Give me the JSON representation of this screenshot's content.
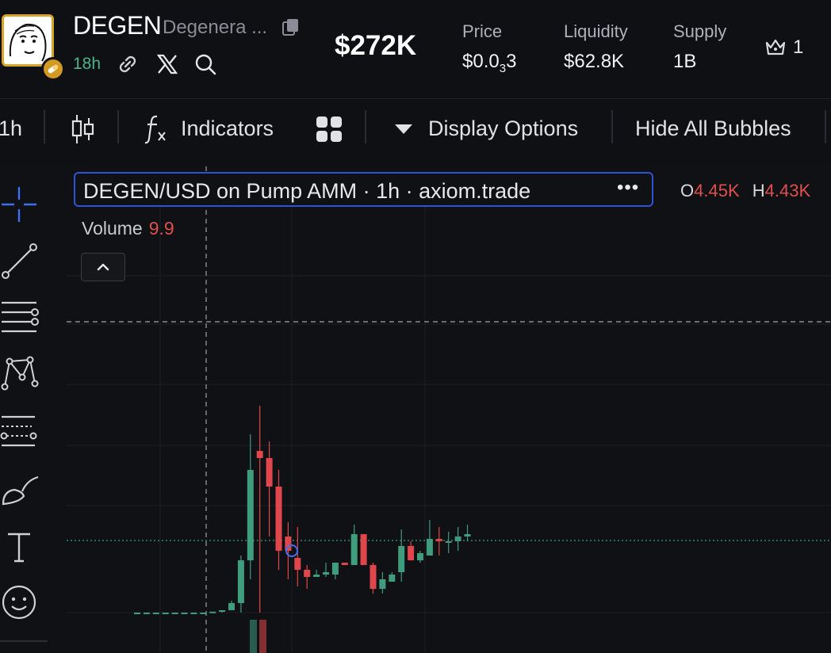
{
  "header": {
    "symbol": "DEGEN",
    "name": "Degenera ...",
    "age": "18h",
    "market_cap": "$272K",
    "stats": {
      "price_label": "Price",
      "price_value_main": "$0.0",
      "price_value_sub": "3",
      "price_value_tail": "3",
      "liquidity_label": "Liquidity",
      "liquidity_value": "$62.8K",
      "supply_label": "Supply",
      "supply_value": "1B"
    },
    "holders_count": "1"
  },
  "toolbar": {
    "interval": "1h",
    "indicators_label": "Indicators",
    "display_options_label": "Display Options",
    "hide_bubbles_label": "Hide All Bubbles"
  },
  "chart": {
    "legend_title": "DEGEN/USD on Pump AMM · 1h · axiom.trade",
    "legend_more": "•••",
    "ohlc": {
      "o_label": "O",
      "o_value": "4.45K",
      "h_label": "H",
      "h_value": "4.43K"
    },
    "volume_label": "Volume",
    "volume_value": "9.9"
  },
  "colors": {
    "up": "#3f9c7c",
    "down": "#e0474c",
    "accent": "#2f53d6",
    "badge": "#d39a22",
    "age_green": "#4fb286"
  },
  "icons": [
    "copy-icon",
    "pill-icon",
    "link-icon",
    "x-logo-icon",
    "search-icon",
    "crown-icon",
    "candlestick-icon",
    "function-icon",
    "grid-icon",
    "caret-down-icon",
    "crosshair-icon",
    "trend-line-icon",
    "horizontal-lines-icon",
    "pattern-icon",
    "fib-icon",
    "brush-icon",
    "text-icon",
    "emoji-icon",
    "chevron-up-icon"
  ],
  "chart_data": {
    "type": "candlestick",
    "interval": "1h",
    "candles": [
      {
        "o": 2.2,
        "h": 2.2,
        "l": 2.2,
        "c": 2.2
      },
      {
        "o": 2.2,
        "h": 2.2,
        "l": 2.2,
        "c": 2.2
      },
      {
        "o": 2.2,
        "h": 2.2,
        "l": 2.2,
        "c": 2.2
      },
      {
        "o": 2.2,
        "h": 2.2,
        "l": 2.2,
        "c": 2.2
      },
      {
        "o": 2.2,
        "h": 2.2,
        "l": 2.2,
        "c": 2.2
      },
      {
        "o": 2.2,
        "h": 2.2,
        "l": 2.2,
        "c": 2.2
      },
      {
        "o": 2.2,
        "h": 2.2,
        "l": 2.2,
        "c": 2.2
      },
      {
        "o": 2.2,
        "h": 2.2,
        "l": 2.2,
        "c": 2.2
      },
      {
        "o": 2.2,
        "h": 2.2,
        "l": 2.2,
        "c": 2.22
      },
      {
        "o": 2.22,
        "h": 2.25,
        "l": 2.2,
        "c": 2.25
      },
      {
        "o": 2.25,
        "h": 2.45,
        "l": 2.25,
        "c": 2.4
      },
      {
        "o": 2.4,
        "h": 3.4,
        "l": 2.2,
        "c": 3.3
      },
      {
        "o": 3.3,
        "h": 5.95,
        "l": 2.9,
        "c": 5.2
      },
      {
        "o": 5.6,
        "h": 6.55,
        "l": 2.2,
        "c": 5.45
      },
      {
        "o": 5.45,
        "h": 5.8,
        "l": 3.8,
        "c": 4.85
      },
      {
        "o": 4.85,
        "h": 5.2,
        "l": 3.1,
        "c": 3.5
      },
      {
        "o": 3.8,
        "h": 4.1,
        "l": 2.9,
        "c": 3.5
      },
      {
        "o": 3.35,
        "h": 4.0,
        "l": 2.75,
        "c": 3.1
      },
      {
        "o": 3.1,
        "h": 3.2,
        "l": 2.7,
        "c": 2.95
      },
      {
        "o": 2.95,
        "h": 3.1,
        "l": 2.95,
        "c": 3.0
      },
      {
        "o": 3.0,
        "h": 3.25,
        "l": 2.95,
        "c": 3.05
      },
      {
        "o": 3.0,
        "h": 3.25,
        "l": 2.9,
        "c": 3.25
      },
      {
        "o": 3.25,
        "h": 3.25,
        "l": 3.2,
        "c": 3.2
      },
      {
        "o": 3.2,
        "h": 4.05,
        "l": 3.2,
        "c": 3.85
      },
      {
        "o": 3.85,
        "h": 3.85,
        "l": 3.2,
        "c": 3.2
      },
      {
        "o": 3.2,
        "h": 3.25,
        "l": 2.6,
        "c": 2.7
      },
      {
        "o": 2.7,
        "h": 3.05,
        "l": 2.6,
        "c": 2.9
      },
      {
        "o": 2.85,
        "h": 3.05,
        "l": 2.85,
        "c": 3.0
      },
      {
        "o": 3.05,
        "h": 3.95,
        "l": 2.85,
        "c": 3.6
      },
      {
        "o": 3.6,
        "h": 3.7,
        "l": 3.3,
        "c": 3.3
      },
      {
        "o": 3.3,
        "h": 3.5,
        "l": 3.25,
        "c": 3.45
      },
      {
        "o": 3.4,
        "h": 4.15,
        "l": 3.4,
        "c": 3.75
      },
      {
        "o": 3.75,
        "h": 4.0,
        "l": 3.4,
        "c": 3.7
      },
      {
        "o": 3.7,
        "h": 3.9,
        "l": 3.45,
        "c": 3.7
      },
      {
        "o": 3.7,
        "h": 4.0,
        "l": 3.5,
        "c": 3.8
      },
      {
        "o": 3.8,
        "h": 4.05,
        "l": 3.7,
        "c": 3.85
      }
    ],
    "volume": [
      {
        "v": 1.0,
        "dir": "up"
      },
      {
        "v": 1.0,
        "dir": "down"
      }
    ],
    "last_price": 3.8,
    "grid": true
  }
}
